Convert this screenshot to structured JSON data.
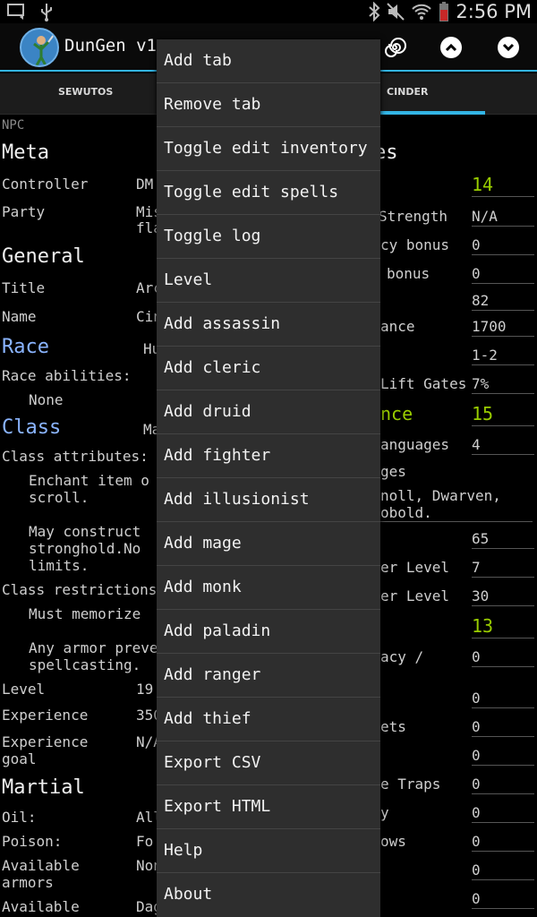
{
  "status_bar": {
    "time": "2:56 PM"
  },
  "app": {
    "title": "DunGen v1"
  },
  "tabs": [
    "SEWUTOS",
    "CINDER"
  ],
  "left": {
    "npc_label": "NPC",
    "meta_heading": "Meta",
    "controller_label": "Controller",
    "controller_value": "DM",
    "party_label": "Party",
    "party_value_1": "Mis",
    "party_value_2": "fla",
    "general_heading": "General",
    "title_label": "Title",
    "title_value": "Arc",
    "name_label": "Name",
    "name_value": "Cin",
    "race_heading": "Race",
    "race_value": "Hu",
    "race_abilities_label": "Race abilities:",
    "race_abilities_value": "None",
    "class_heading": "Class",
    "class_value": "Ma",
    "class_attributes_label": "Class attributes:",
    "attr_1_line_1": "Enchant item o",
    "attr_1_line_2": "scroll.",
    "attr_2_line_1": "May construct",
    "attr_2_line_2": "stronghold.No",
    "attr_2_line_3": "limits.",
    "class_restrictions_label": "Class restrictions",
    "restr_1": "Must memorize",
    "restr_2_line_1": "Any armor preve",
    "restr_2_line_2": "spellcasting.",
    "level_label": "Level",
    "level_value": "19",
    "experience_label": "Experience",
    "experience_value": "350",
    "exp_goal_label_1": "Experience",
    "exp_goal_label_2": "goal",
    "exp_goal_value": "N/A",
    "martial_heading": "Martial",
    "oil_label": "Oil:",
    "oil_value": "All",
    "poison_label": "Poison:",
    "poison_value": "Fo",
    "armors_label_1": "Available",
    "armors_label_2": "armors",
    "armors_value": "Non",
    "available2_label": "Available",
    "available2_value": "Dag"
  },
  "right": {
    "heading_frag": "es",
    "v_str_big": "14",
    "str_label": "Strength",
    "str_value": "N/A",
    "acc_label": "cy bonus",
    "acc_value": "0",
    "dmg_label": "bonus",
    "dmg_value": "0",
    "v_82": "82",
    "ance_label": "ance",
    "v_1700": "1700",
    "v_12": "1-2",
    "gates_label": "Lift Gates",
    "gates_value": "7%",
    "int_heading_frag": "nce",
    "int_value": "15",
    "lang_label": "anguages",
    "lang_value": "4",
    "ges_label": "ges",
    "lang_list_1": "noll, Dwarven,",
    "lang_list_2": "obold.",
    "v_65": "65",
    "lvl1_label": "er Level",
    "lvl1_value": "7",
    "lvl2_label": "er Level",
    "lvl2_value": "30",
    "wis_value": "13",
    "acy_label": "acy /",
    "acy_value": "0",
    "z1": "0",
    "ets_label": "ets",
    "z2": "0",
    "z3": "0",
    "traps_label": "e Traps",
    "z4": "0",
    "y_label": "y",
    "z5": "0",
    "ows_label": "ows",
    "z6": "0",
    "z7": "0",
    "z8": "0"
  },
  "menu": [
    "Add tab",
    "Remove tab",
    "Toggle edit inventory",
    "Toggle edit spells",
    "Toggle log",
    "Level",
    "Add assassin",
    "Add cleric",
    "Add druid",
    "Add fighter",
    "Add illusionist",
    "Add mage",
    "Add monk",
    "Add paladin",
    "Add ranger",
    "Add thief",
    "Export CSV",
    "Export HTML",
    "Help",
    "About"
  ]
}
